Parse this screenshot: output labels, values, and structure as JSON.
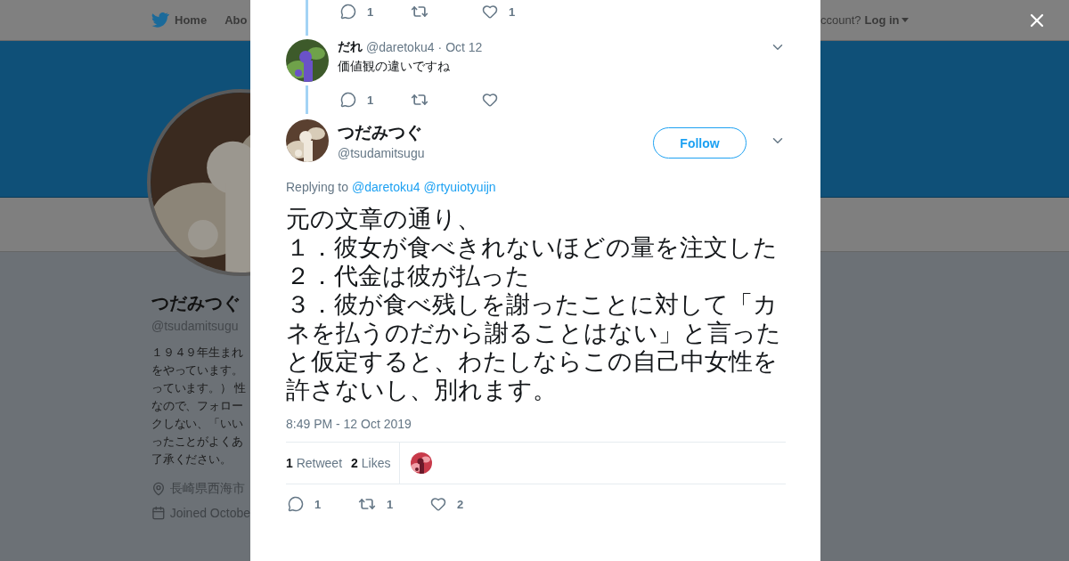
{
  "background_page": {
    "nav": {
      "home": "Home",
      "about": "Abo",
      "account_prompt": "ccount?",
      "login": "Log in"
    },
    "profile": {
      "name": "つだみつぐ",
      "handle": "@tsudamitsugu",
      "bio_lines": [
        "１９４９年生まれ",
        "をやっています。",
        "っています。） 性",
        "なので、フォロー",
        "クしない、「いい",
        "ったことがよくあ",
        "了承ください。"
      ],
      "location": "長崎県西海市",
      "joined": "Joined Octobe"
    }
  },
  "previous_tweet_actions": {
    "reply": "1",
    "like": "1"
  },
  "reply_tweet": {
    "name": "だれ",
    "handle": "@daretoku4",
    "separator": "·",
    "date": "Oct 12",
    "text": "価値観の違いですね",
    "actions": {
      "reply": "1"
    }
  },
  "main_tweet": {
    "name": "つだみつぐ",
    "handle": "@tsudamitsugu",
    "follow": "Follow",
    "replying_prefix": "Replying to",
    "replying_to": [
      "@daretoku4",
      "@rtyuiotyuijn"
    ],
    "text_lines": [
      "元の文章の通り、",
      "１．彼女が食べきれないほどの量を注文した",
      "２．代金は彼が払った",
      "３．彼が食べ残しを謝ったことに対して「カネを払うのだから謝ることはない」と言った",
      "と仮定すると、わたしならこの自己中女性を許さないし、別れます。"
    ],
    "timestamp": "8:49 PM - 12 Oct 2019",
    "stats": {
      "retweet_count": "1",
      "retweet_label": "Retweet",
      "like_count": "2",
      "like_label": "Likes"
    },
    "actions": {
      "reply": "1",
      "retweet": "1",
      "like": "2"
    }
  }
}
